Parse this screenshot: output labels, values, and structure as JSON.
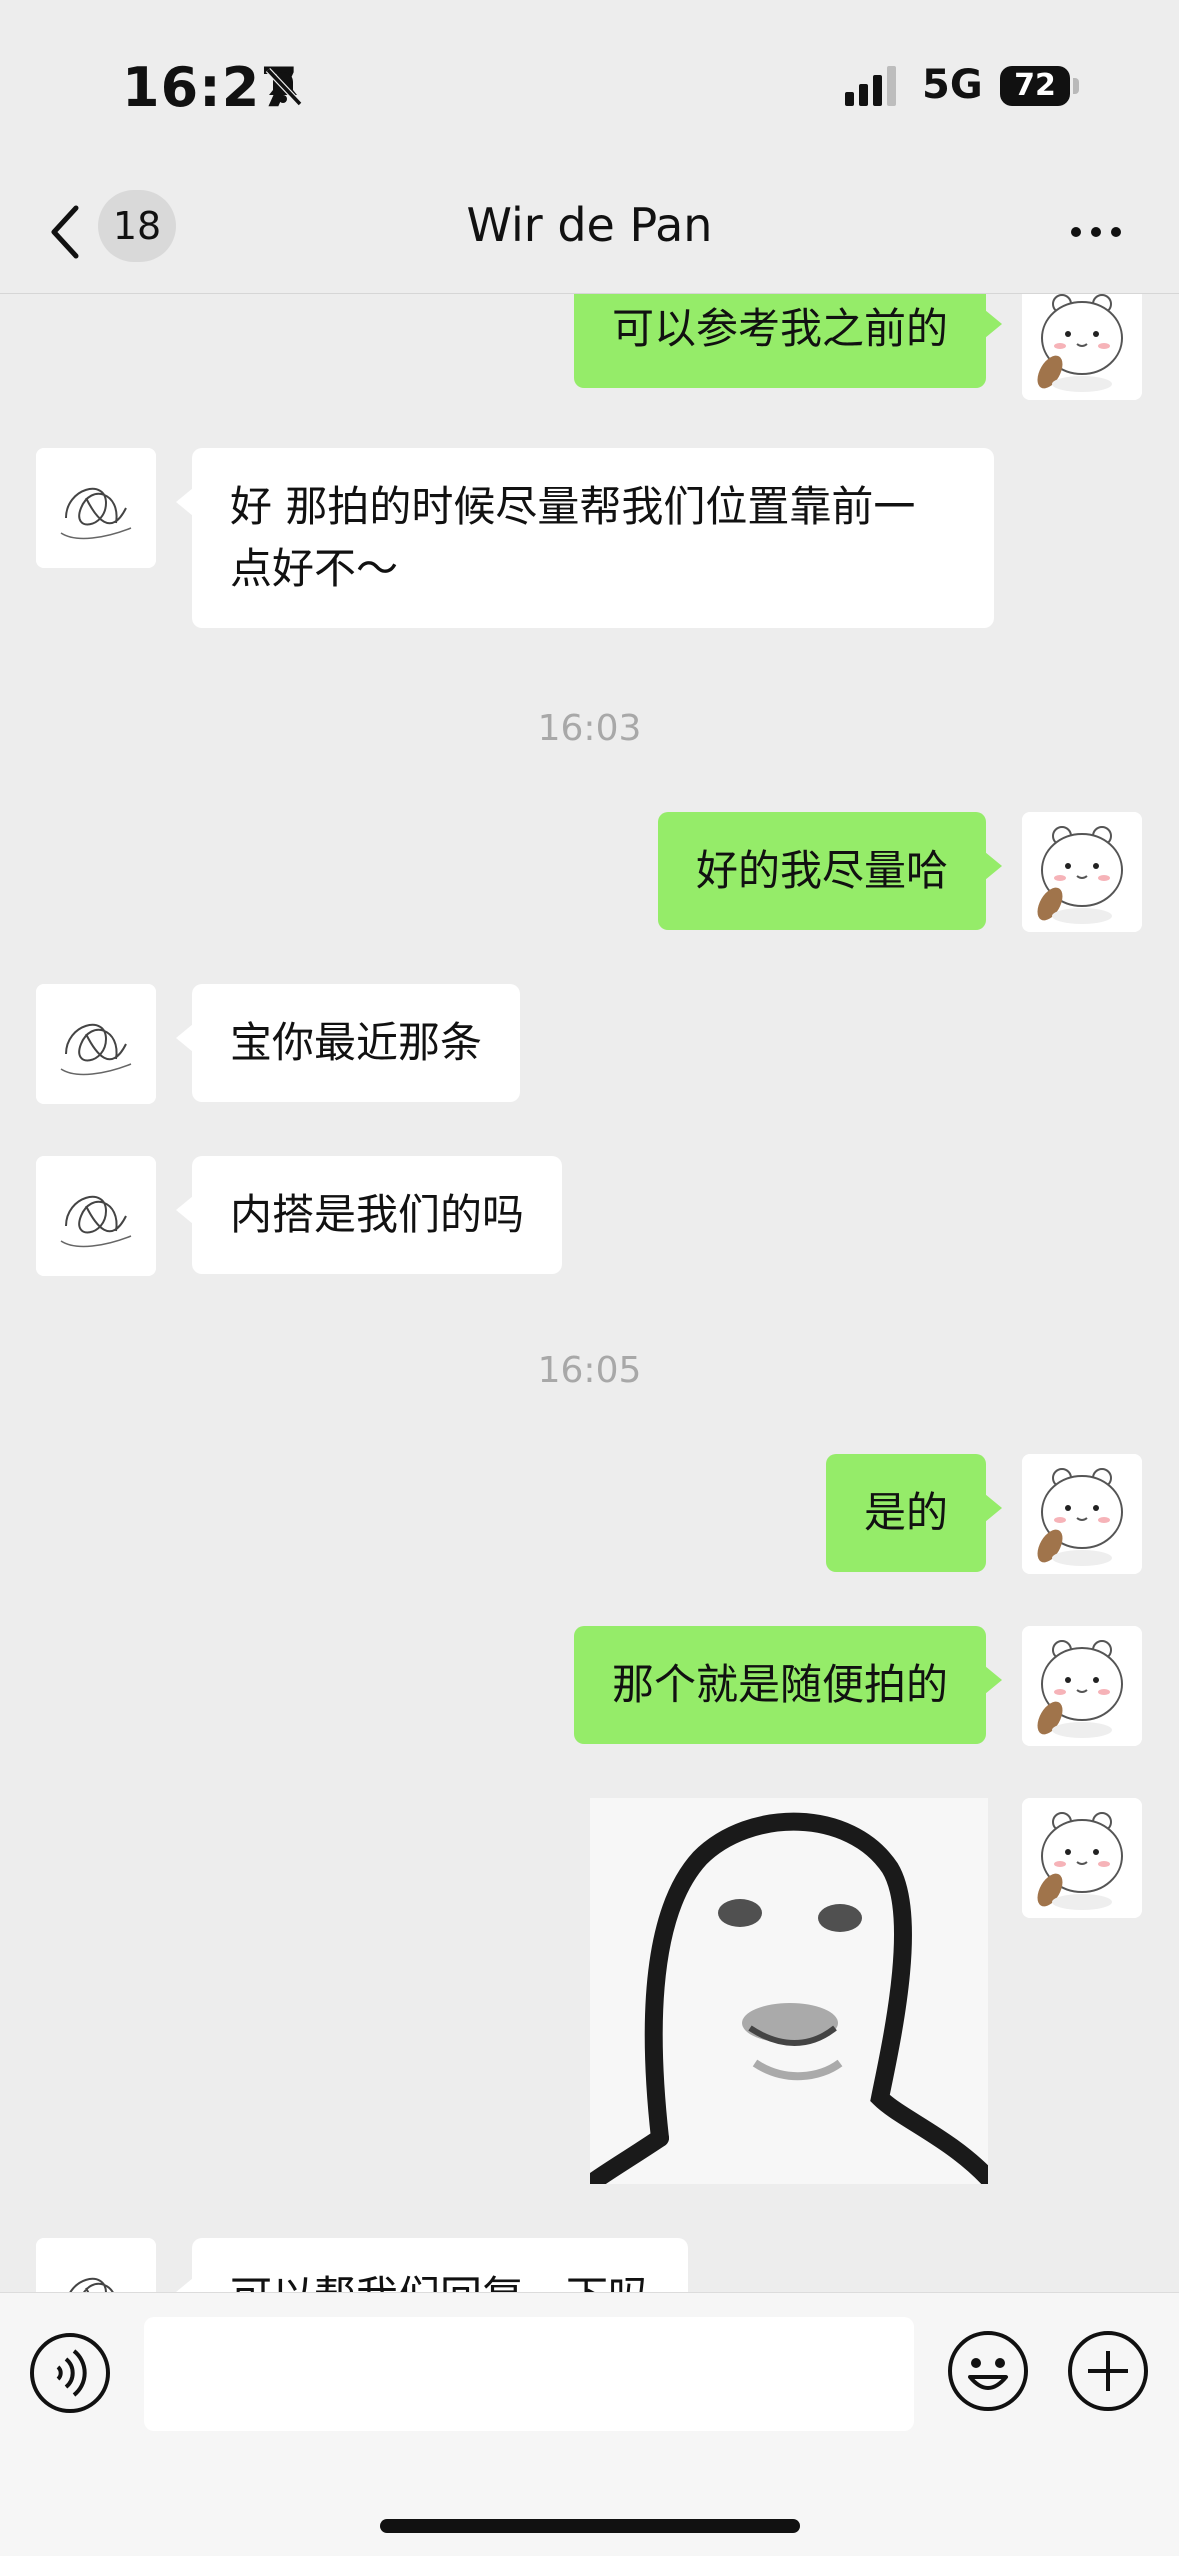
{
  "status_bar": {
    "time": "16:27",
    "network": "5G",
    "battery": "72",
    "mute_icon": "bell-slash-icon",
    "signal_icon": "signal-bars-icon"
  },
  "nav": {
    "back_icon": "chevron-left-icon",
    "unread_count": "18",
    "title": "Wir de Pan",
    "more_icon": "ellipsis-icon"
  },
  "messages": [
    {
      "side": "out",
      "type": "text",
      "text": "可以参考我之前的"
    },
    {
      "side": "in",
      "type": "text",
      "text": "好 那拍的时候尽量帮我们位置靠前一点好不～"
    },
    {
      "type": "time",
      "text": "16:03"
    },
    {
      "side": "out",
      "type": "text",
      "text": "好的我尽量哈"
    },
    {
      "side": "in",
      "type": "text",
      "text": "宝你最近那条"
    },
    {
      "side": "in",
      "type": "text",
      "text": "内搭是我们的吗"
    },
    {
      "type": "time",
      "text": "16:05"
    },
    {
      "side": "out",
      "type": "text",
      "text": "是的"
    },
    {
      "side": "out",
      "type": "text",
      "text": "那个就是随便拍的"
    },
    {
      "side": "out",
      "type": "sticker",
      "sticker": "meme-face-sticker"
    },
    {
      "side": "in",
      "type": "text",
      "text": "可以帮我们回复一下吗"
    }
  ],
  "input_bar": {
    "voice_icon": "voice-icon",
    "emoji_icon": "smiley-icon",
    "plus_icon": "plus-circle-icon",
    "input_value": ""
  },
  "colors": {
    "background": "#ededed",
    "outgoing_bubble": "#95ec69",
    "incoming_bubble": "#ffffff",
    "timestamp": "#a8a8a8"
  }
}
